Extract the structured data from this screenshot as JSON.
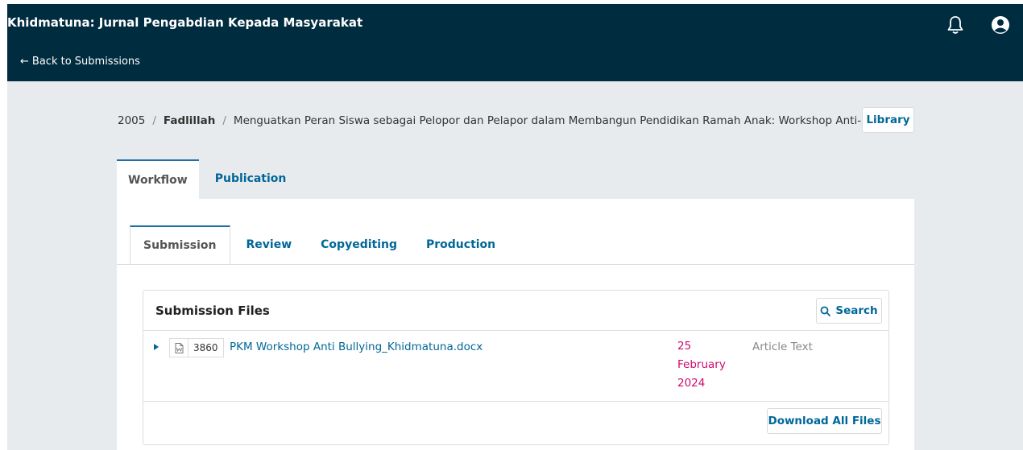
{
  "header": {
    "journal_title": "Khidmatuna: Jurnal Pengabdian Kepada Masyarakat",
    "back_link": "Back to Submissions",
    "back_arrow": "←",
    "icons": [
      "bell-icon",
      "user-icon"
    ]
  },
  "breadcrumb": {
    "id": "2005",
    "author": "Fadlillah",
    "title": "Menguatkan Peran Siswa sebagai Pelopor dan Pelapor dalam Membangun Pendidikan Ramah Anak: Workshop Anti-",
    "separator": "/"
  },
  "library_button": "Library",
  "main_tabs": [
    {
      "label": "Workflow",
      "active": true
    },
    {
      "label": "Publication",
      "active": false
    }
  ],
  "sub_tabs": [
    {
      "label": "Submission",
      "active": true
    },
    {
      "label": "Review",
      "active": false
    },
    {
      "label": "Copyediting",
      "active": false
    },
    {
      "label": "Production",
      "active": false
    }
  ],
  "submission_files": {
    "title": "Submission Files",
    "search_label": "Search",
    "rows": [
      {
        "id": "3860",
        "name": "PKM Workshop Anti Bullying_Khidmatuna.docx",
        "date_lines": [
          "25",
          "February",
          "2024"
        ],
        "type": "Article Text"
      }
    ],
    "download_all_label": "Download All Files"
  },
  "colors": {
    "header_bg": "#002c40",
    "link": "#006798",
    "date": "#d00a6c",
    "page_bg": "#e8ebed"
  }
}
